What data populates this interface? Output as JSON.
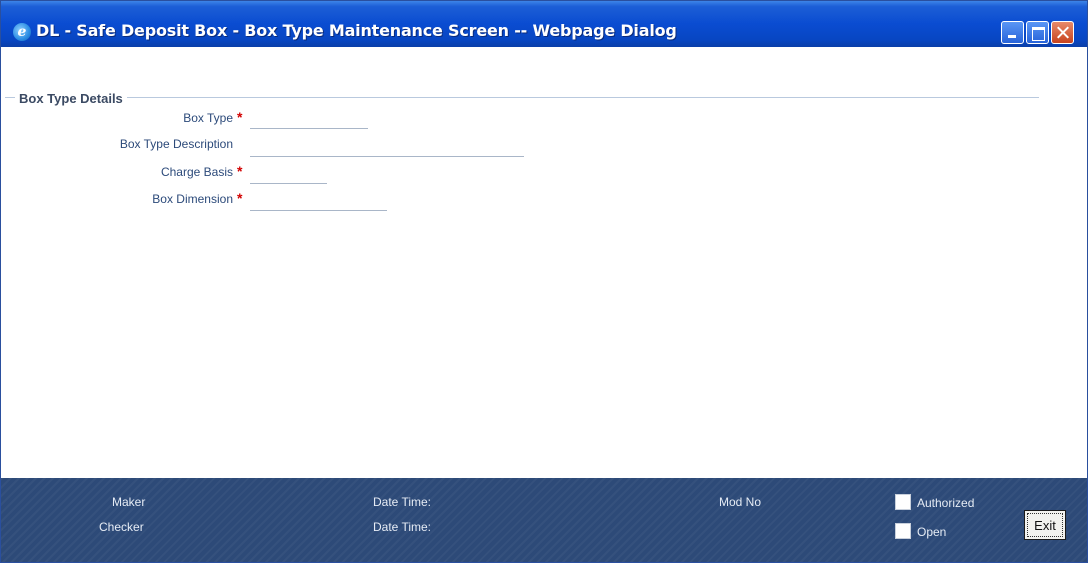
{
  "window": {
    "title": "DL - Safe Deposit Box - Box Type Maintenance Screen -- Webpage Dialog",
    "icon": "ie-icon"
  },
  "section": {
    "legend": "Box Type Details"
  },
  "fields": {
    "box_type": {
      "label": "Box Type",
      "required": "*",
      "value": ""
    },
    "box_type_description": {
      "label": "Box Type Description",
      "value": ""
    },
    "charge_basis": {
      "label": "Charge Basis",
      "required": "*",
      "value": ""
    },
    "box_dimension": {
      "label": "Box Dimension",
      "required": "*",
      "value": ""
    }
  },
  "footer": {
    "maker_label": "Maker",
    "checker_label": "Checker",
    "maker_datetime_label": "Date Time:",
    "checker_datetime_label": "Date Time:",
    "mod_no_label": "Mod No",
    "authorized_label": "Authorized",
    "open_label": "Open",
    "exit_label": "Exit"
  },
  "colors": {
    "title_bar": "#0a4cd1",
    "footer_bg": "#2d4a78",
    "required_marker": "#d20000",
    "label_text": "#2c4a7a"
  }
}
